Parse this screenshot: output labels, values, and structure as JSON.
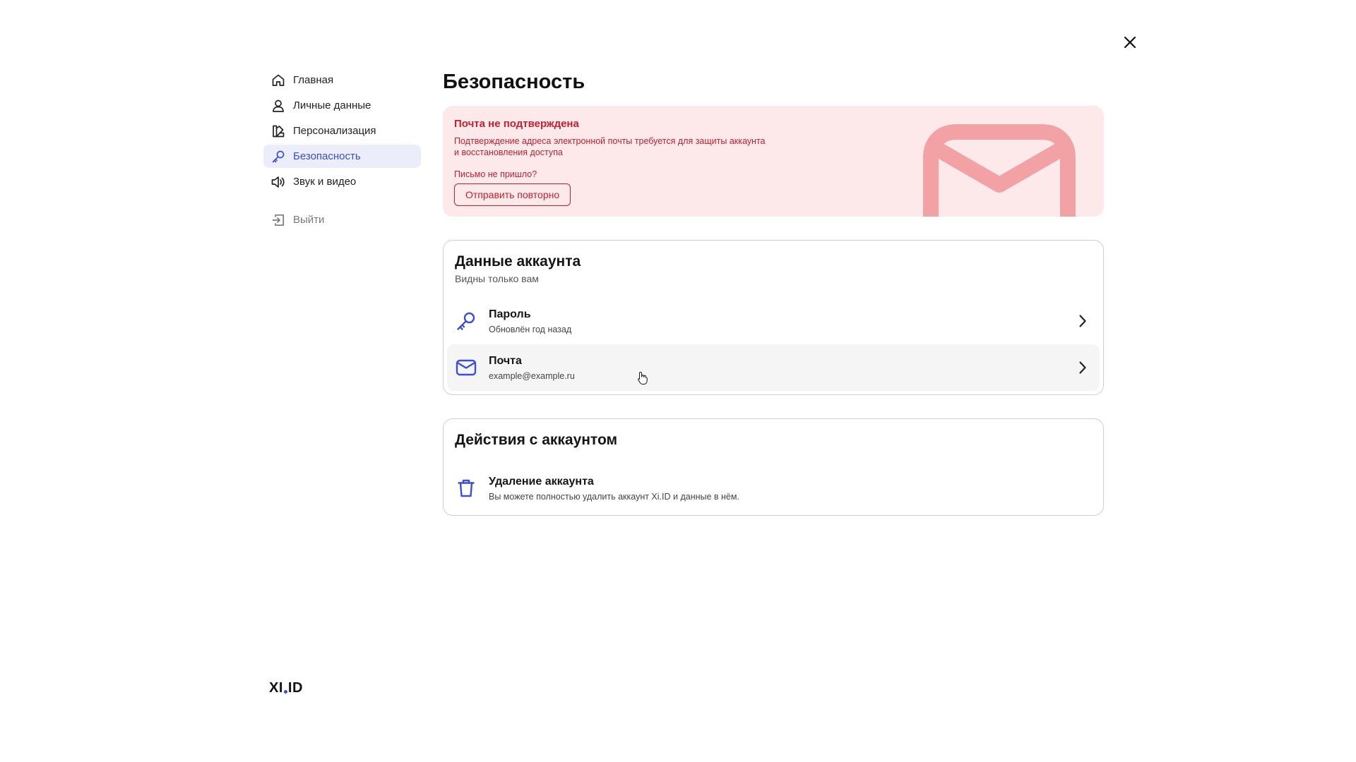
{
  "sidebar": {
    "items": [
      {
        "label": "Главная",
        "icon": "home-icon"
      },
      {
        "label": "Личные данные",
        "icon": "user-icon"
      },
      {
        "label": "Персонализация",
        "icon": "brush-icon"
      },
      {
        "label": "Безопасность",
        "icon": "key-icon"
      },
      {
        "label": "Звук и видео",
        "icon": "speaker-icon"
      }
    ],
    "logout": {
      "label": "Выйти",
      "icon": "logout-icon"
    }
  },
  "brand": {
    "left": "XI",
    "right": "ID"
  },
  "page": {
    "title": "Безопасность"
  },
  "alert": {
    "title": "Почта не подтверждена",
    "text_line1": "Подтверждение адреса электронной почты требуется для защиты аккаунта",
    "text_line2": "и восстановления доступа",
    "question": "Письмо не пришло?",
    "resend_label": "Отправить повторно",
    "icon": "mail-icon"
  },
  "account_data": {
    "title": "Данные аккаунта",
    "subtitle": "Видны только вам",
    "rows": [
      {
        "title": "Пароль",
        "subtitle": "Обновлён год назад",
        "icon": "key-icon"
      },
      {
        "title": "Почта",
        "subtitle": "example@example.ru",
        "icon": "mail-icon"
      }
    ]
  },
  "account_actions": {
    "title": "Действия с аккаунтом",
    "rows": [
      {
        "title": "Удаление аккаунта",
        "subtitle": "Вы можете полностью удалить аккаунт Xi.ID и данные в нём.",
        "icon": "trash-icon"
      }
    ]
  },
  "colors": {
    "accent": "#3b4ed6",
    "active_bg": "#ebedfb",
    "alert_bg": "#fde8ea",
    "alert_text": "#c8202f",
    "alert_art": "#f2a1a5"
  }
}
